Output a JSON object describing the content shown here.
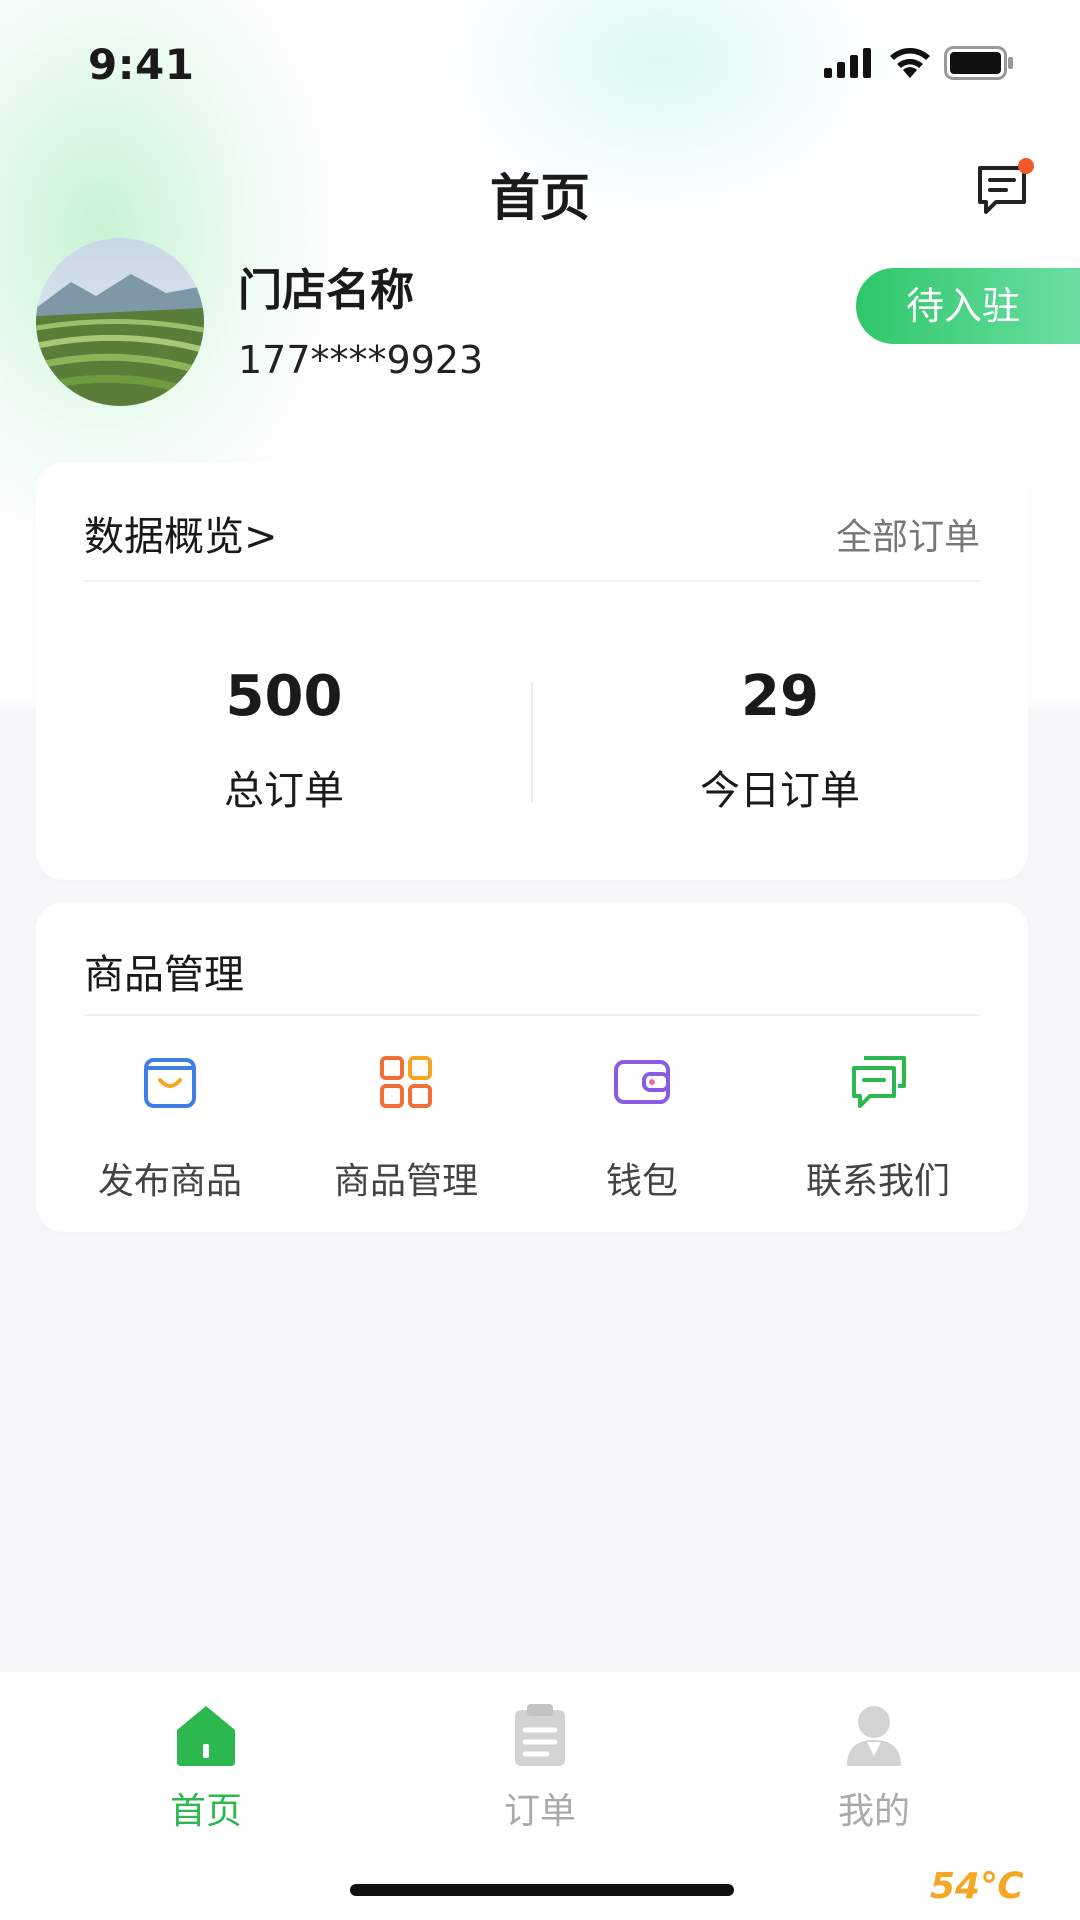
{
  "status_bar": {
    "time": "9:41"
  },
  "nav": {
    "title": "首页",
    "message_icon": "message-icon",
    "unread_color": "#f25a2a"
  },
  "store": {
    "name": "门店名称",
    "phone": "177****9923",
    "status": "待入驻"
  },
  "overview": {
    "title": "数据概览>",
    "link": "全部订单",
    "stats": [
      {
        "value": "500",
        "label": "总订单"
      },
      {
        "value": "29",
        "label": "今日订单"
      }
    ]
  },
  "goods": {
    "title": "商品管理",
    "items": [
      {
        "label": "发布商品",
        "icon": "shopping-bag-icon",
        "color": "#3f7ee8"
      },
      {
        "label": "商品管理",
        "icon": "grid-icon",
        "color": "#ef6f34"
      },
      {
        "label": "钱包",
        "icon": "wallet-icon",
        "color": "#8a5ce6"
      },
      {
        "label": "联系我们",
        "icon": "chat-icon",
        "color": "#2cb84f"
      }
    ]
  },
  "tabs": [
    {
      "label": "首页",
      "icon": "home-icon",
      "active": true
    },
    {
      "label": "订单",
      "icon": "clipboard-icon",
      "active": false
    },
    {
      "label": "我的",
      "icon": "user-icon",
      "active": false
    }
  ],
  "watermark": {
    "text": "54℃"
  },
  "colors": {
    "accent": "#2cb84f",
    "tab_inactive": "#aaaaaa"
  }
}
